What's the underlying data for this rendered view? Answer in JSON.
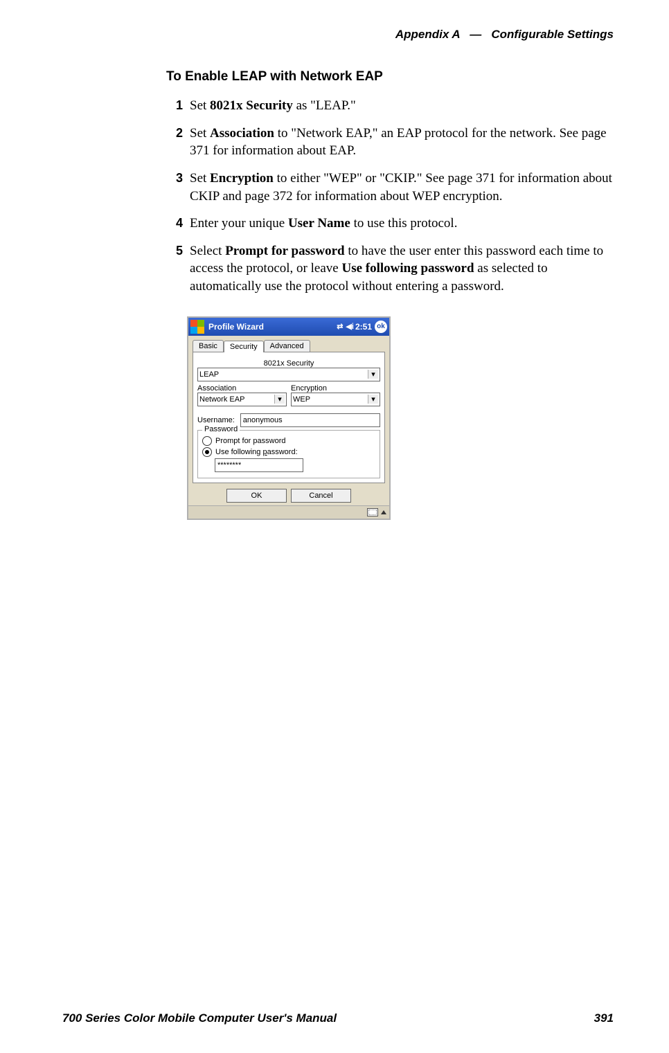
{
  "header": {
    "appendix": "Appendix A",
    "sep": "—",
    "title": "Configurable Settings"
  },
  "section_title": "To Enable LEAP with Network EAP",
  "steps": {
    "1": {
      "num": "1",
      "pre": "Set ",
      "bold1": "8021x Security",
      "post": " as \"LEAP.\""
    },
    "2": {
      "num": "2",
      "pre": "Set ",
      "bold1": "Association",
      "post": " to \"Network EAP,\" an EAP protocol for the network. See page 371 for information about EAP."
    },
    "3": {
      "num": "3",
      "pre": "Set ",
      "bold1": "Encryption",
      "post": " to either \"WEP\" or \"CKIP.\" See page 371 for information about CKIP and page 372 for information about WEP encryption."
    },
    "4": {
      "num": "4",
      "pre": "Enter your unique ",
      "bold1": "User Name",
      "post": " to use this protocol."
    },
    "5": {
      "num": "5",
      "pre": "Select ",
      "bold1": "Prompt for password",
      "mid": " to have the user enter this password each time to access the protocol, or leave ",
      "bold2": "Use following password",
      "post": " as selected to automatically use the protocol without entering a password."
    }
  },
  "wizard": {
    "title": "Profile Wizard",
    "time": "2:51",
    "ok": "ok",
    "tabs": {
      "basic": "Basic",
      "security": "Security",
      "advanced": "Advanced"
    },
    "sec_label": "8021x Security",
    "sec_value": "LEAP",
    "assoc_label": "Association",
    "assoc_value": "Network EAP",
    "enc_label": "Encryption",
    "enc_value": "WEP",
    "user_label": "Username:",
    "user_value": "anonymous",
    "pw_group": "Password",
    "radio_prompt": "Prompt for password",
    "radio_use_pre": "Use following ",
    "radio_use_under": "p",
    "radio_use_post": "assword:",
    "pw_masked": "********",
    "btn_ok": "OK",
    "btn_cancel": "Cancel"
  },
  "footer": {
    "left": "700 Series Color Mobile Computer User's Manual",
    "right": "391"
  }
}
